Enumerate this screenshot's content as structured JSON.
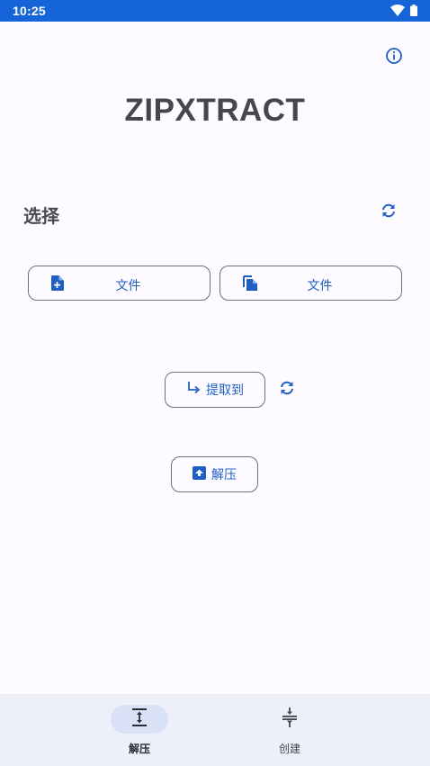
{
  "status_bar": {
    "time": "10:25",
    "icons": [
      "wifi-icon",
      "battery-icon"
    ]
  },
  "header": {
    "info_icon": "info-icon",
    "title": "ZIPXTRACT"
  },
  "select_section": {
    "label": "选择",
    "refresh_icon": "refresh-icon",
    "file_button_1": {
      "label": "文件",
      "icon": "file-add-icon"
    },
    "file_button_2": {
      "label": "文件",
      "icon": "files-copy-icon"
    }
  },
  "extract_to": {
    "label": "提取到",
    "icon": "subdirectory-arrow-icon",
    "refresh_icon": "refresh-icon"
  },
  "decompress": {
    "label": "解压",
    "icon": "archive-icon"
  },
  "bottom_nav": {
    "items": [
      {
        "label": "解压",
        "icon": "expand-vertical-icon",
        "active": true
      },
      {
        "label": "创建",
        "icon": "compress-vertical-icon",
        "active": false
      }
    ]
  },
  "colors": {
    "accent": "#1f5fc4",
    "status_bar": "#1565d8",
    "background": "#fdfbff",
    "nav_background": "#eef0f9",
    "nav_active_pill": "#d9e2f7"
  }
}
